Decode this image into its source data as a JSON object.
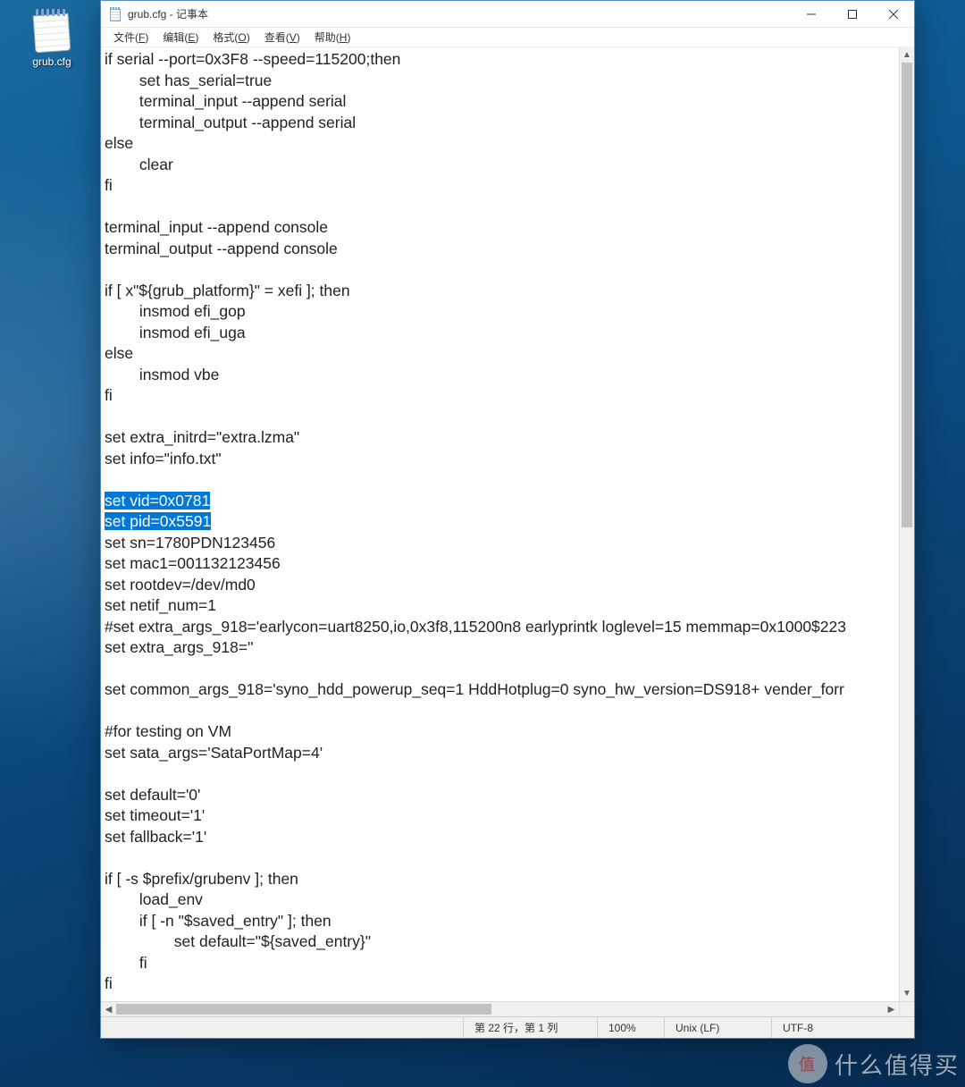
{
  "desktop": {
    "icon_label": "grub.cfg"
  },
  "window": {
    "title": "grub.cfg - 记事本"
  },
  "menu": {
    "file": {
      "label": "文件",
      "accel": "F"
    },
    "edit": {
      "label": "编辑",
      "accel": "E"
    },
    "format": {
      "label": "格式",
      "accel": "O"
    },
    "view": {
      "label": "查看",
      "accel": "V"
    },
    "help": {
      "label": "帮助",
      "accel": "H"
    }
  },
  "editor": {
    "pre_selection": "if serial --port=0x3F8 --speed=115200;then\n        set has_serial=true\n        terminal_input --append serial\n        terminal_output --append serial\nelse\n        clear\nfi\n\nterminal_input --append console\nterminal_output --append console\n\nif [ x\"${grub_platform}\" = xefi ]; then\n        insmod efi_gop\n        insmod efi_uga\nelse\n        insmod vbe\nfi\n\nset extra_initrd=\"extra.lzma\"\nset info=\"info.txt\"\n\n",
    "selection_line1": "set vid=0x0781",
    "selection_line2": "set pid=0x5591",
    "post_selection": "\nset sn=1780PDN123456\nset mac1=001132123456\nset rootdev=/dev/md0\nset netif_num=1\n#set extra_args_918='earlycon=uart8250,io,0x3f8,115200n8 earlyprintk loglevel=15 memmap=0x1000$223\nset extra_args_918=''\n\nset common_args_918='syno_hdd_powerup_seq=1 HddHotplug=0 syno_hw_version=DS918+ vender_forr\n\n#for testing on VM\nset sata_args='SataPortMap=4'\n\nset default='0'\nset timeout='1'\nset fallback='1'\n\nif [ -s $prefix/grubenv ]; then\n        load_env\n        if [ -n \"$saved_entry\" ]; then\n                set default=\"${saved_entry}\"\n        fi\nfi"
  },
  "status": {
    "position": "第 22 行，第 1 列",
    "zoom": "100%",
    "eol": "Unix (LF)",
    "encoding": "UTF-8"
  },
  "watermark": {
    "badge": "值",
    "text": "什么值得买"
  }
}
